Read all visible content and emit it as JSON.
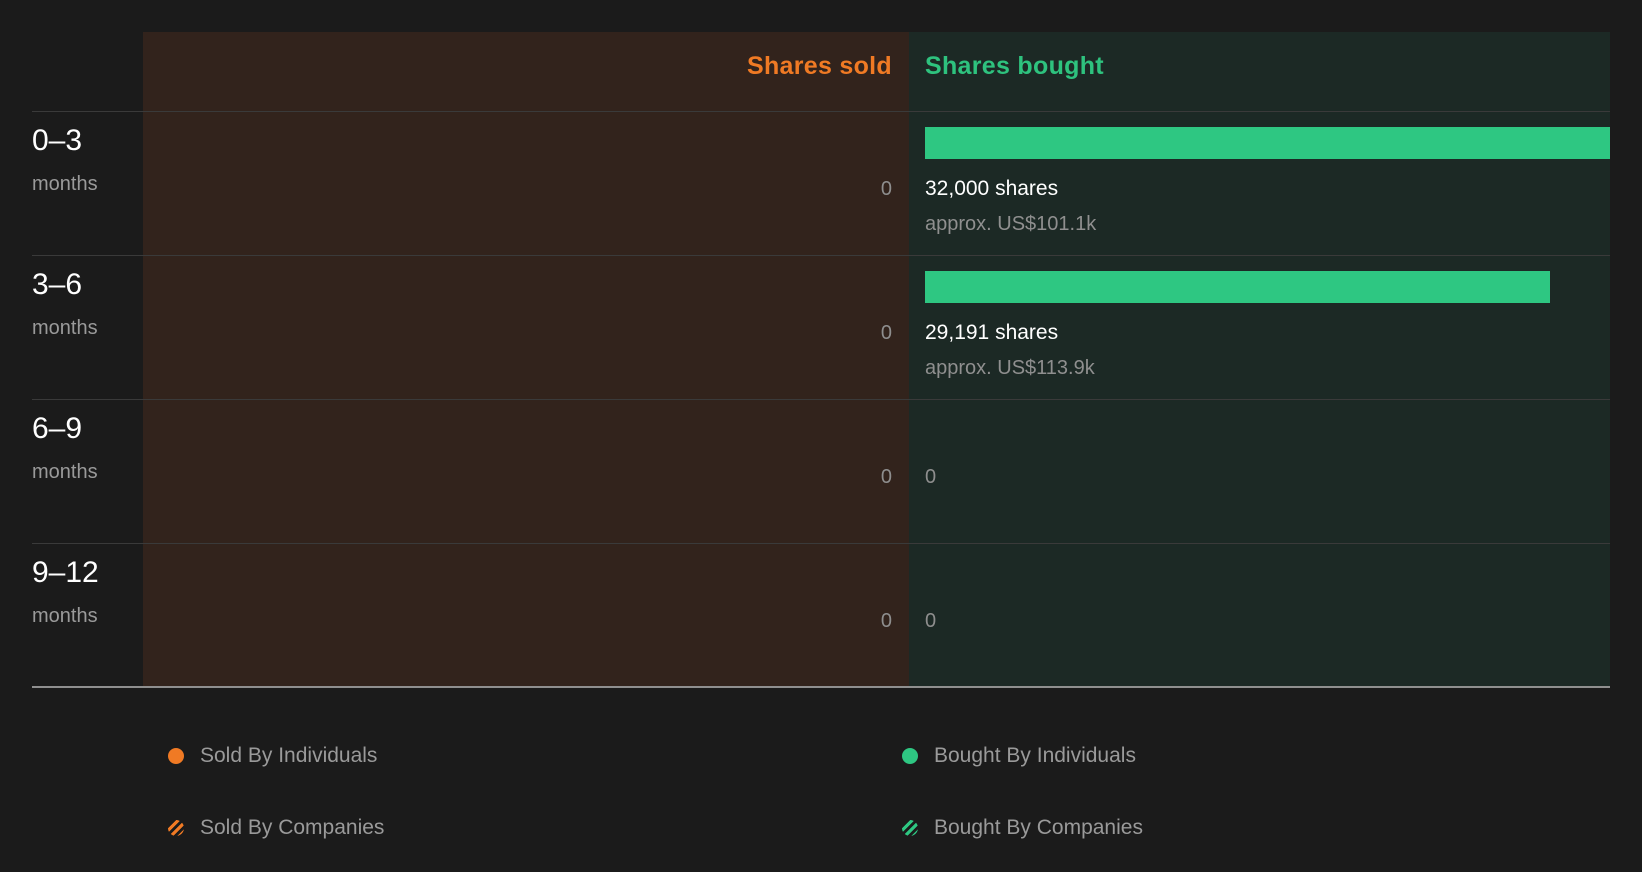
{
  "chart_data": {
    "type": "bar",
    "title": "",
    "headers": {
      "sold": "Shares sold",
      "bought": "Shares bought"
    },
    "max_shares": 32000,
    "rows": [
      {
        "range": "0–3",
        "unit": "months",
        "sold": "0",
        "bought_shares": 32000,
        "bought_label": "32,000 shares",
        "bought_approx": "approx. US$101.1k",
        "bought_zero": ""
      },
      {
        "range": "3–6",
        "unit": "months",
        "sold": "0",
        "bought_shares": 29191,
        "bought_label": "29,191 shares",
        "bought_approx": "approx. US$113.9k",
        "bought_zero": ""
      },
      {
        "range": "6–9",
        "unit": "months",
        "sold": "0",
        "bought_shares": 0,
        "bought_label": "",
        "bought_approx": "",
        "bought_zero": "0"
      },
      {
        "range": "9–12",
        "unit": "months",
        "sold": "0",
        "bought_shares": 0,
        "bought_label": "",
        "bought_approx": "",
        "bought_zero": "0"
      }
    ],
    "legend": [
      {
        "label": "Sold By Individuals",
        "color": "#f07a24",
        "pattern": "solid"
      },
      {
        "label": "Bought By Individuals",
        "color": "#2ec782",
        "pattern": "solid"
      },
      {
        "label": "Sold By Companies",
        "color": "#f07a24",
        "pattern": "hatched"
      },
      {
        "label": "Bought By Companies",
        "color": "#2ec782",
        "pattern": "hatched"
      }
    ],
    "colors": {
      "sold": "#f07a24",
      "bought": "#2ec782",
      "sold_panel": "#32231c",
      "bought_panel": "#1c2925"
    }
  }
}
